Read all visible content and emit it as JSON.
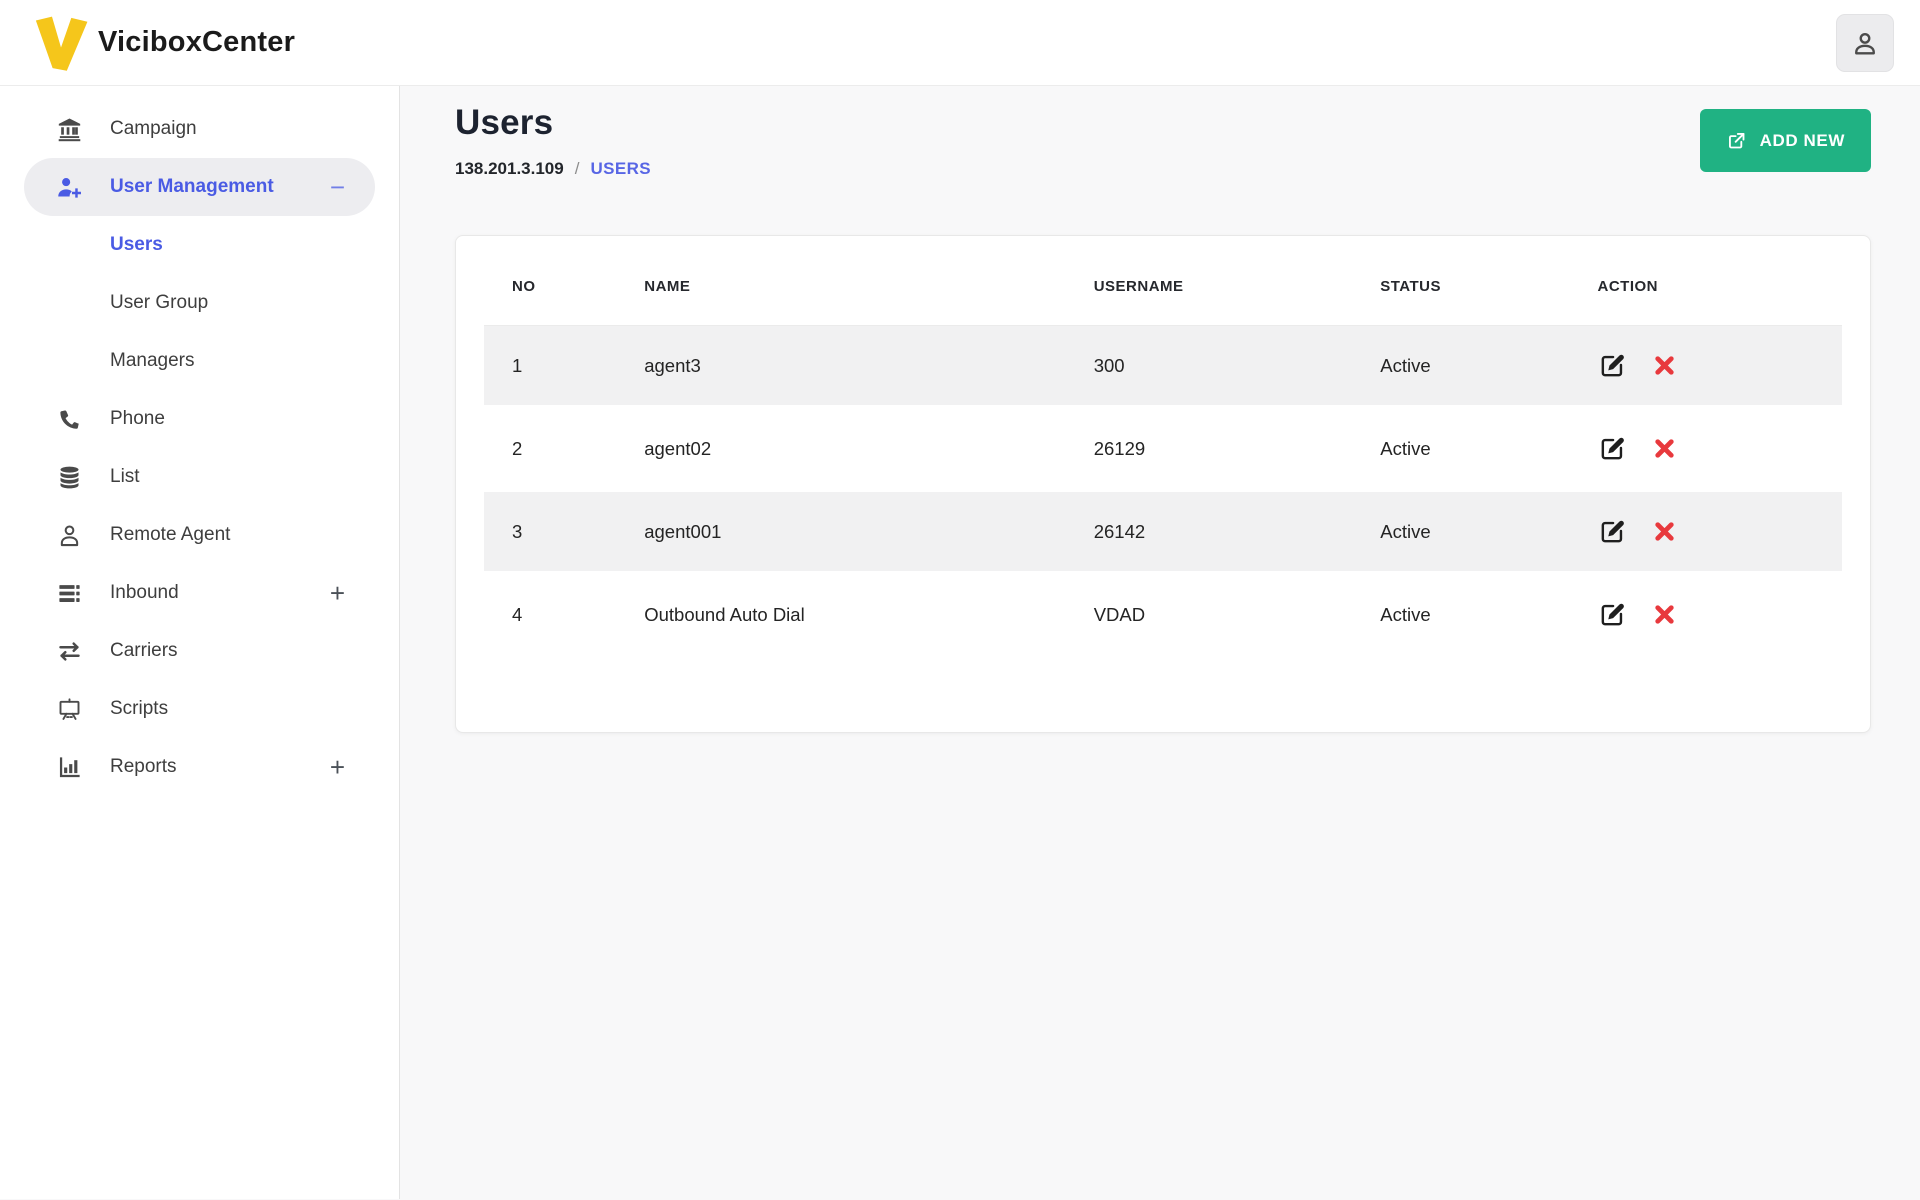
{
  "header": {
    "brand": "ViciboxCenter",
    "logo_icon": "v-logo-icon",
    "account_icon": "account-icon"
  },
  "sidebar": {
    "items": [
      {
        "label": "Campaign",
        "icon": "bank-icon",
        "type": "top",
        "active": false,
        "suffix": ""
      },
      {
        "label": "User Management",
        "icon": "user-plus-icon",
        "type": "top",
        "active": true,
        "suffix": "minus"
      },
      {
        "label": "Users",
        "icon": "",
        "type": "sub",
        "active": true,
        "suffix": ""
      },
      {
        "label": "User Group",
        "icon": "",
        "type": "sub",
        "active": false,
        "suffix": ""
      },
      {
        "label": "Managers",
        "icon": "",
        "type": "sub",
        "active": false,
        "suffix": ""
      },
      {
        "label": "Phone",
        "icon": "phone-icon",
        "type": "top",
        "active": false,
        "suffix": ""
      },
      {
        "label": "List",
        "icon": "database-icon",
        "type": "top",
        "active": false,
        "suffix": ""
      },
      {
        "label": "Remote Agent",
        "icon": "person-icon",
        "type": "top",
        "active": false,
        "suffix": ""
      },
      {
        "label": "Inbound",
        "icon": "rows-icon",
        "type": "top",
        "active": false,
        "suffix": "plus"
      },
      {
        "label": "Carriers",
        "icon": "exchange-icon",
        "type": "top",
        "active": false,
        "suffix": ""
      },
      {
        "label": "Scripts",
        "icon": "presentation-icon",
        "type": "top",
        "active": false,
        "suffix": ""
      },
      {
        "label": "Reports",
        "icon": "bar-chart-icon",
        "type": "top",
        "active": false,
        "suffix": "plus"
      }
    ]
  },
  "main": {
    "title": "Users",
    "breadcrumb": {
      "host": "138.201.3.109",
      "separator": "/",
      "page": "USERS"
    },
    "add_button": {
      "label": "ADD NEW",
      "icon": "external-link-icon"
    }
  },
  "table": {
    "columns": [
      "NO",
      "NAME",
      "USERNAME",
      "STATUS",
      "ACTION"
    ],
    "rows": [
      {
        "no": "1",
        "name": "agent3",
        "username": "300",
        "status": "Active"
      },
      {
        "no": "2",
        "name": "agent02",
        "username": "26129",
        "status": "Active"
      },
      {
        "no": "3",
        "name": "agent001",
        "username": "26142",
        "status": "Active"
      },
      {
        "no": "4",
        "name": "Outbound Auto Dial",
        "username": "VDAD",
        "status": "Active"
      }
    ],
    "row_actions": [
      {
        "icon": "edit-icon"
      },
      {
        "icon": "delete-icon"
      }
    ]
  },
  "colors": {
    "accent": "#4a5be4",
    "green": "#20b283",
    "red": "#e8393d",
    "yellow": "#f5c61b"
  }
}
